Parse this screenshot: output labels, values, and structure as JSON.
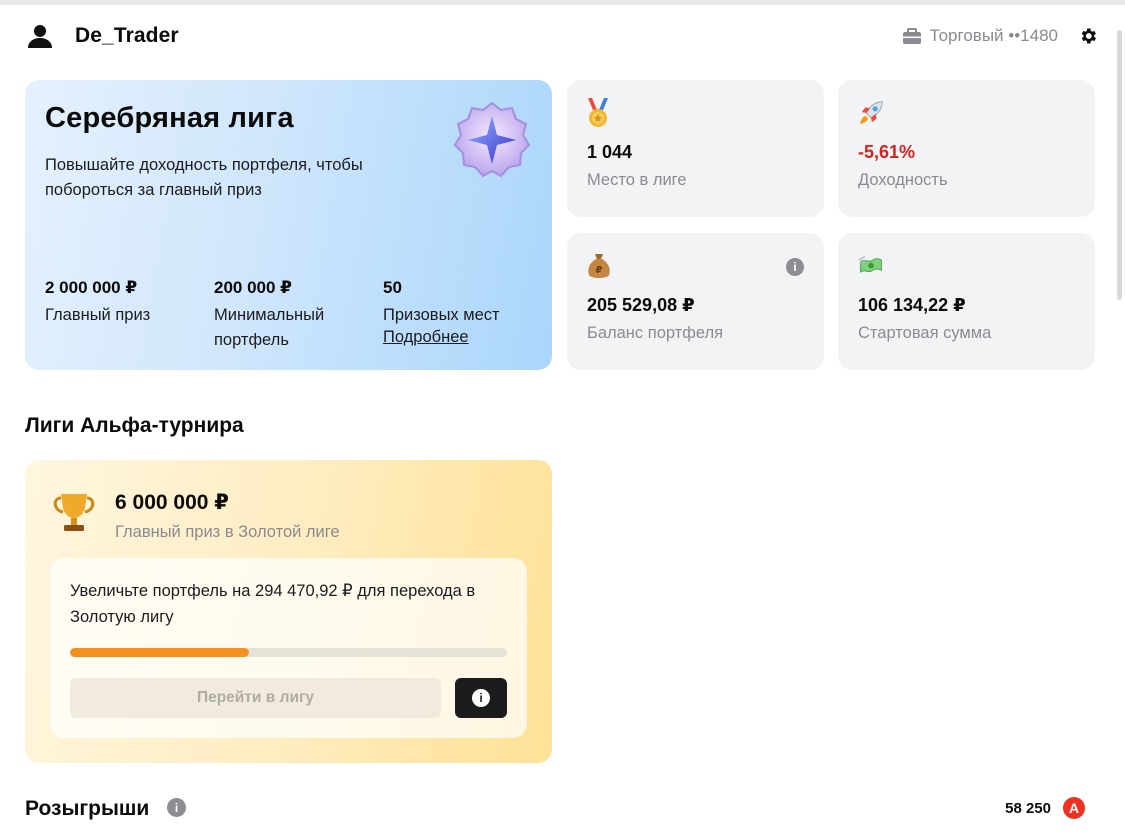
{
  "header": {
    "username": "De_Trader",
    "account_label": "Торговый ••1480"
  },
  "silver": {
    "title": "Серебряная лига",
    "description": "Повышайте доходность портфеля, чтобы побороться за главный приз",
    "stats": [
      {
        "value": "2 000 000 ₽",
        "label": "Главный приз"
      },
      {
        "value": "200 000 ₽",
        "label": "Минимальный портфель"
      },
      {
        "value": "50",
        "label": "Призовых мест",
        "link": "Подробнее"
      }
    ]
  },
  "metrics": {
    "place": {
      "value": "1 044",
      "label": "Место в лиге"
    },
    "yield": {
      "value": "-5,61%",
      "label": "Доходность"
    },
    "balance": {
      "value": "205 529,08 ₽",
      "label": "Баланс портфеля"
    },
    "start": {
      "value": "106 134,22 ₽",
      "label": "Стартовая сумма"
    }
  },
  "leagues": {
    "title": "Лиги Альфа-турнира",
    "prize_value": "6 000 000 ₽",
    "prize_label": "Главный приз в Золотой лиге",
    "upgrade_text": "Увеличьте портфель на 294 470,92 ₽ для перехода в Золотую лигу",
    "progress": 0.41,
    "go_button": "Перейти в лигу"
  },
  "raffles": {
    "title": "Розыгрыши",
    "points": "58 250",
    "logo_letter": "A"
  },
  "colors": {
    "accent_orange": "#f4911e",
    "negative_red": "#d4221f",
    "alfa_red": "#ef3124"
  }
}
